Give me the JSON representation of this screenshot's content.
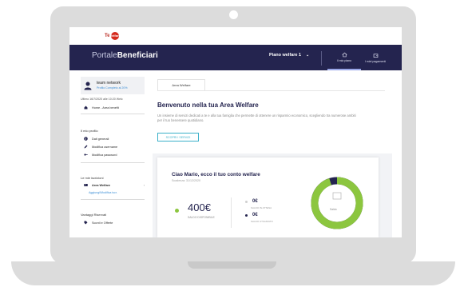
{
  "header": {
    "logo_text": "Te",
    "logo_badge": "Welfare",
    "brand_light": "Portale",
    "brand_bold": "Beneficiari",
    "user_menu_label": "Piano welfare 1"
  },
  "nav_tabs": [
    {
      "label": "Il mio piano",
      "icon": "home-icon",
      "active": true
    },
    {
      "label": "I miei pagamenti",
      "icon": "wallet-icon",
      "active": false
    }
  ],
  "sidebar": {
    "profile_name": "team network",
    "profile_link": "Profilo Completo al 20%",
    "last_access": "Ultimo 16/7/2020 alle 10:20 Welc",
    "home_link": "Home - Area benefit",
    "section_profile": "Il mio profilo",
    "profile_items": [
      {
        "label": "Dati generali",
        "icon": "info-icon"
      },
      {
        "label": "Modifica username",
        "icon": "pencil-icon"
      },
      {
        "label": "Modifica password",
        "icon": "key-icon"
      }
    ],
    "section_benefits": "Le mie iscrizioni",
    "benefit_item": "Area Welfare",
    "benefit_link": "Aggiungi/Modifica iscr.",
    "section_agreements": "Vantaggi Riservati",
    "agreement_item": "Sconti e Offerte"
  },
  "main": {
    "tab_label": "Area Welfare",
    "welcome_title": "Benvenuto nella tua Area Welfare",
    "welcome_desc": "Un insieme di servizi dedicati a te e alla tua famiglia che permette di ottenere un risparmio economico, scegliendo tra numerose ambiti per il tuo benessere quotidiano.",
    "cta_label": "SCOPRI I SERVIZI"
  },
  "account": {
    "title": "Ciao Mario, ecco il tuo conto welfare",
    "date": "Scadenza: 31/12/2020",
    "available_amount": "400€",
    "available_label": "SALDO DISPONIBILE",
    "sub_items": [
      {
        "amount": "0€",
        "label": "SALDO IN ATTESA",
        "color": "#cfcfcf"
      },
      {
        "amount": "0€",
        "label": "SALDO UTILIZZATO",
        "color": "#24244f"
      }
    ],
    "donut_label": "Saldo",
    "donut_fraction": 0.95,
    "colors": {
      "available": "#8cc63f",
      "used": "#24244f"
    }
  }
}
